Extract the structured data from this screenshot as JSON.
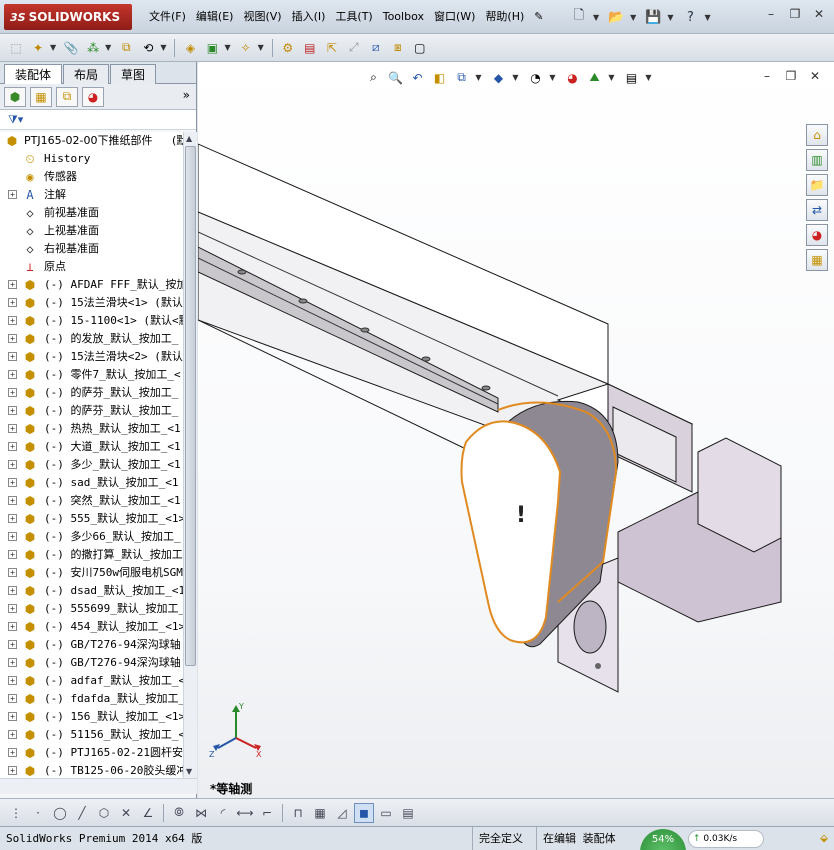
{
  "app": {
    "logo_prefix": "3S",
    "logo_text": "SOLIDWORKS"
  },
  "menu": [
    "文件(F)",
    "编辑(E)",
    "视图(V)",
    "插入(I)",
    "工具(T)",
    "Toolbox",
    "窗口(W)",
    "帮助(H)"
  ],
  "panel": {
    "tabs": [
      "装配体",
      "布局",
      "草图"
    ],
    "active_tab": "装配体"
  },
  "tree": {
    "root": {
      "label": "PTJ165-02-00下推纸部件",
      "config": "(默",
      "icon": "assembly-icon"
    },
    "features": [
      {
        "label": "History",
        "icon": "history-icon"
      },
      {
        "label": "传感器",
        "icon": "sensor-icon"
      },
      {
        "label": "注解",
        "icon": "annotation-icon",
        "expandable": true
      },
      {
        "label": "前视基准面",
        "icon": "plane-icon"
      },
      {
        "label": "上视基准面",
        "icon": "plane-icon"
      },
      {
        "label": "右视基准面",
        "icon": "plane-icon"
      },
      {
        "label": "原点",
        "icon": "origin-icon"
      }
    ],
    "components": [
      "(-) AFDAF FFF_默认_按加",
      "(-) 15法兰滑块<1> (默认",
      "(-) 15-1100<1> (默认<默",
      "(-) 的发放_默认_按加工_",
      "(-) 15法兰滑块<2> (默认",
      "(-) 零件7_默认_按加工_<",
      "(-) 的萨芬_默认_按加工_",
      "(-) 的萨芬_默认_按加工_",
      "(-) 热热_默认_按加工_<1",
      "(-) 大道_默认_按加工_<1",
      "(-) 多少_默认_按加工_<1",
      "(-) sad_默认_按加工_<1",
      "(-) 突然_默认_按加工_<1",
      "(-) 555_默认_按加工_<1>",
      "(-) 多少66_默认_按加工_",
      "(-) 的撒打算_默认_按加工",
      "(-) 安川750w伺服电机SGM",
      "(-) dsad_默认_按加工_<1",
      "(-) 555699_默认_按加工_",
      "(-) 454_默认_按加工_<1>",
      "(-) GB/T276-94深沟球轴",
      "(-) GB/T276-94深沟球轴",
      "(-) adfaf_默认_按加工_<",
      "(-) fdafda_默认_按加工_",
      "(-) 156_默认_按加工_<1>",
      "(-) 51156_默认_按加工_<",
      "(-) PTJ165-02-21圆杆安装",
      "(-) TB125-06-20胶头缓冲"
    ]
  },
  "viewport": {
    "view_name": "*等轴测",
    "triad": {
      "x": "X",
      "y": "Y",
      "z": "Z"
    }
  },
  "status": {
    "product": "SolidWorks Premium 2014 x64 版",
    "definition": "完全定义",
    "mode": "在编辑 装配体",
    "progress_percent": "54%",
    "net_speed": "0.03K/s",
    "net_arrow": "↑"
  },
  "colors": {
    "body_face": "#ffffff",
    "body_side": "#d8d4da",
    "bracket": "#c9bfcf",
    "highlight": "#e08a20",
    "brand": "#b0281f"
  }
}
